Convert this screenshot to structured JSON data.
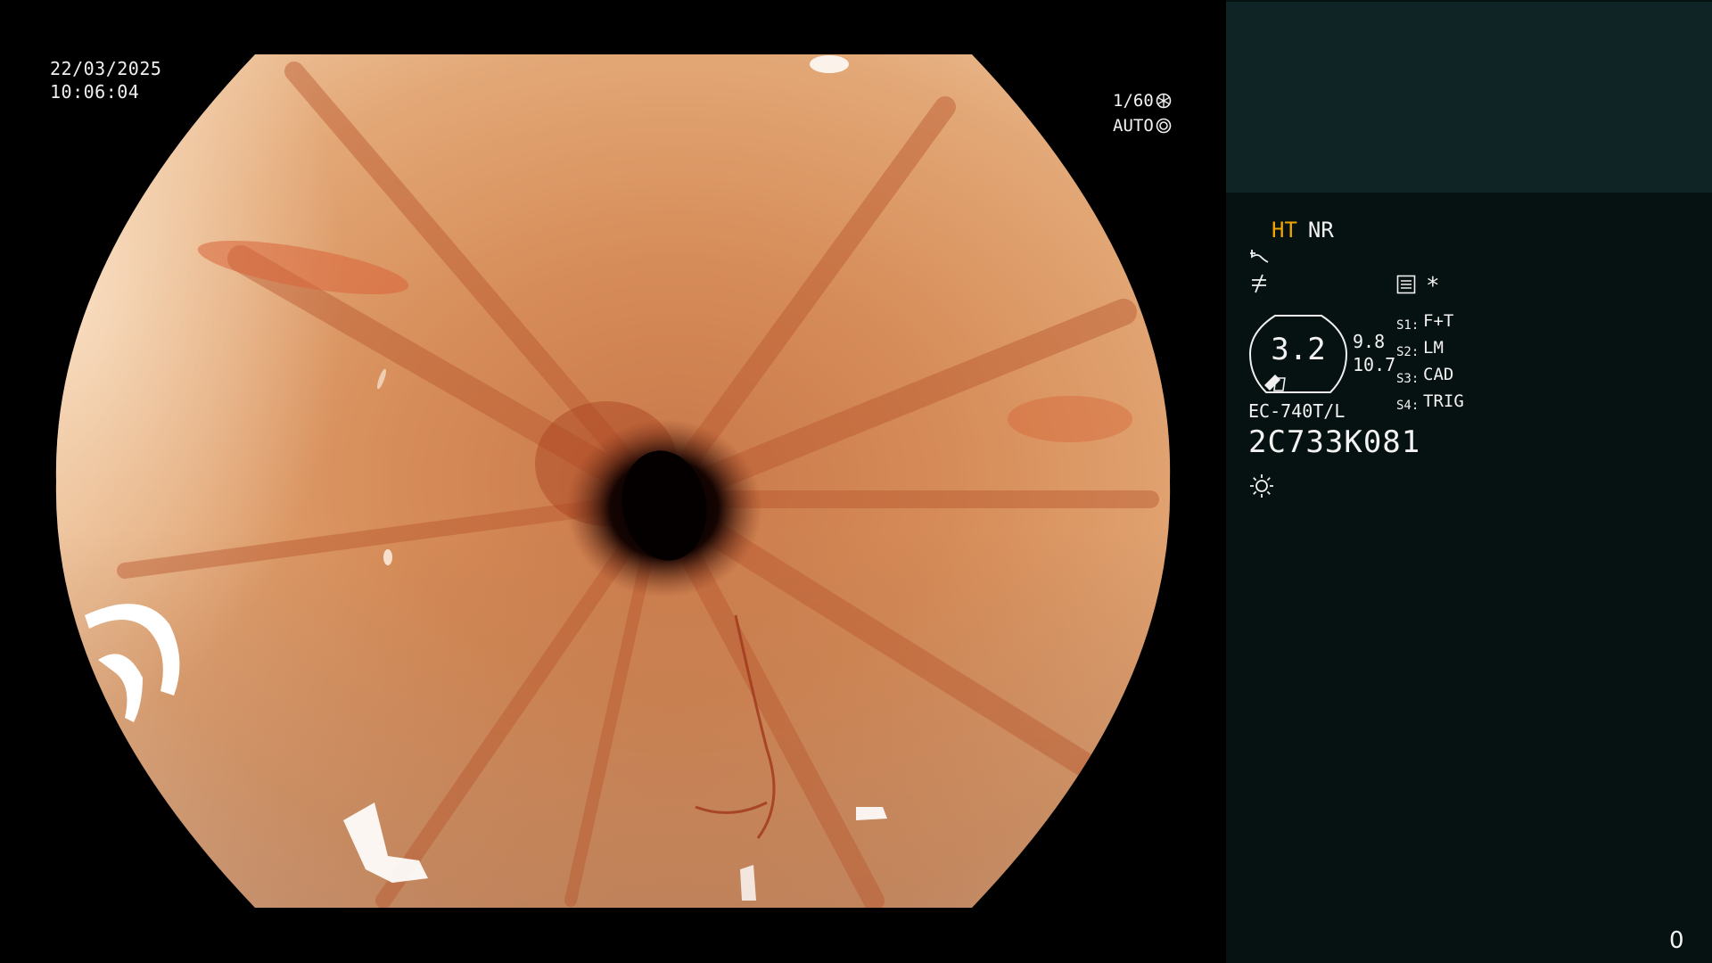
{
  "overlay": {
    "date": "22/03/2025",
    "time": "10:06:04",
    "shutter": "1/60",
    "iris": "AUTO",
    "shutter_icon": "aperture-icon",
    "iris_icon": "iris-ring-icon"
  },
  "panel": {
    "mode_ht": "HT",
    "mode_nr": "NR",
    "enhancement_icon": "enhancement-curve-icon",
    "contrast_icon": "contrast-slash-icon",
    "settings_icon": "preset-list-icon",
    "star_symbol": "*",
    "zoom_value": "3.2",
    "mag_value_1": "9.8",
    "mag_value_2": "10.7",
    "switches": [
      {
        "key": "S1:",
        "value": "F+T"
      },
      {
        "key": "S2:",
        "value": "LM"
      },
      {
        "key": "S3:",
        "value": "CAD"
      },
      {
        "key": "S4:",
        "value": "TRIG"
      }
    ],
    "scope_model": "EC-740T/L",
    "scope_serial": "2C733K081",
    "light_icon": "light-source-icon",
    "frame_counter": "0"
  },
  "colors": {
    "mode_ht": "#f0a500",
    "panel_bg": "#061211",
    "panel_top_bg": "#0f2425",
    "tissue_light": "#f0c8a0",
    "tissue_mid": "#d48a56",
    "tissue_dark": "#a0502c"
  }
}
